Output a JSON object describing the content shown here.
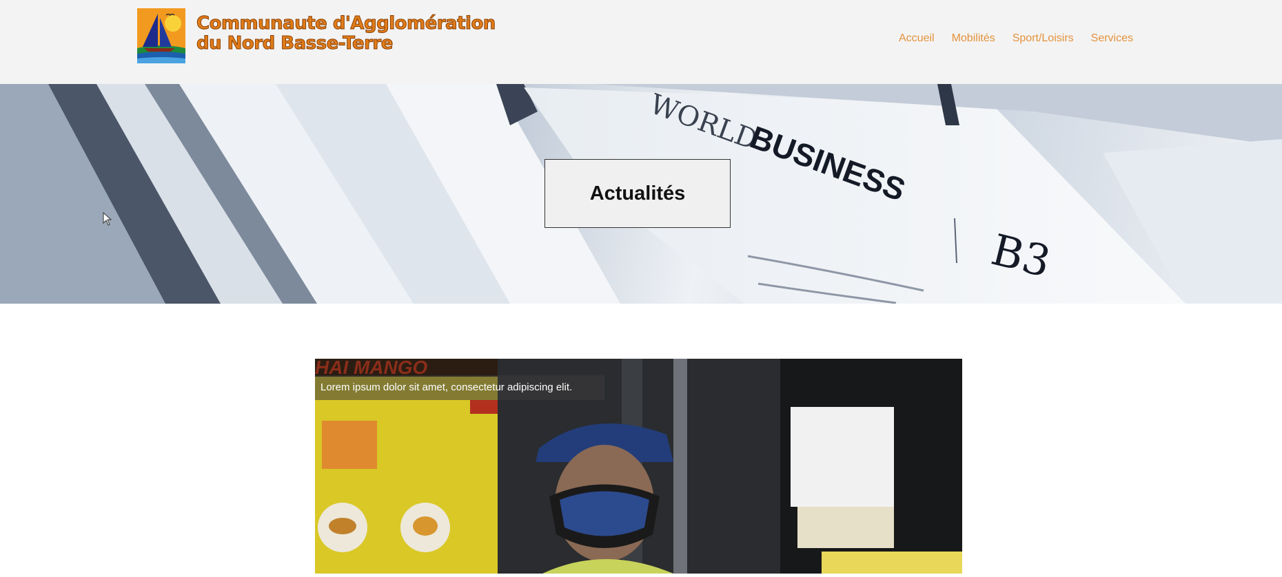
{
  "header": {
    "logo_line1": "Communaute d'Agglomération",
    "logo_line2": "du Nord Basse-Terre",
    "nav": [
      {
        "label": "Accueil"
      },
      {
        "label": "Mobilités"
      },
      {
        "label": "Sport/Loisirs"
      },
      {
        "label": "Services"
      }
    ]
  },
  "hero": {
    "title": "Actualités",
    "image_words": [
      "WORLD",
      "BUSINESS",
      "B3"
    ]
  },
  "card": {
    "caption": "Lorem ipsum dolor sit amet, consectetur adipiscing elit.",
    "image_words": [
      "HAI MANGO"
    ]
  },
  "colors": {
    "accent": "#e4913b",
    "header_bg": "#f3f3f3",
    "logo_text": "#e07c1a"
  },
  "icons": [
    "logo-sailboat-icon",
    "mouse-cursor-icon"
  ]
}
